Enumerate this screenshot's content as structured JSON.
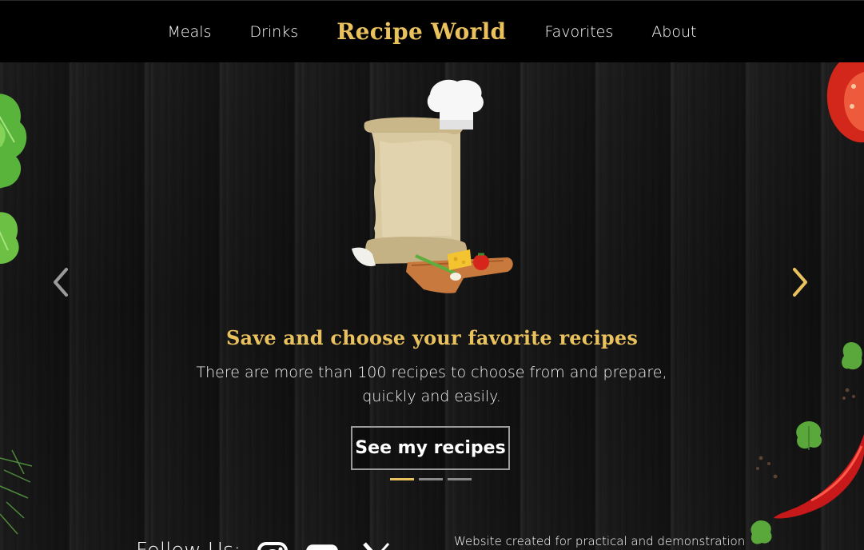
{
  "nav": {
    "meals": "Meals",
    "drinks": "Drinks",
    "brand": "Recipe World",
    "favorites": "Favorites",
    "about": "About"
  },
  "carousel": {
    "title": "Save and choose your favorite recipes",
    "text": "There are more than 100 recipes to choose from and prepare, quickly and easily.",
    "button_label": "See my recipes",
    "slide_count": 3,
    "active_slide": 1,
    "prev_icon": "chevron-left-icon",
    "next_icon": "chevron-right-icon"
  },
  "footer": {
    "follow_label": "Follow Us:",
    "socials": [
      "instagram-icon",
      "youtube-icon",
      "x-icon"
    ],
    "credit": "Website created for practical and demonstration"
  },
  "colors": {
    "accent": "#e9c15d",
    "navbar": "#000000",
    "text": "#ffffff",
    "background": "#1a1a1a"
  }
}
